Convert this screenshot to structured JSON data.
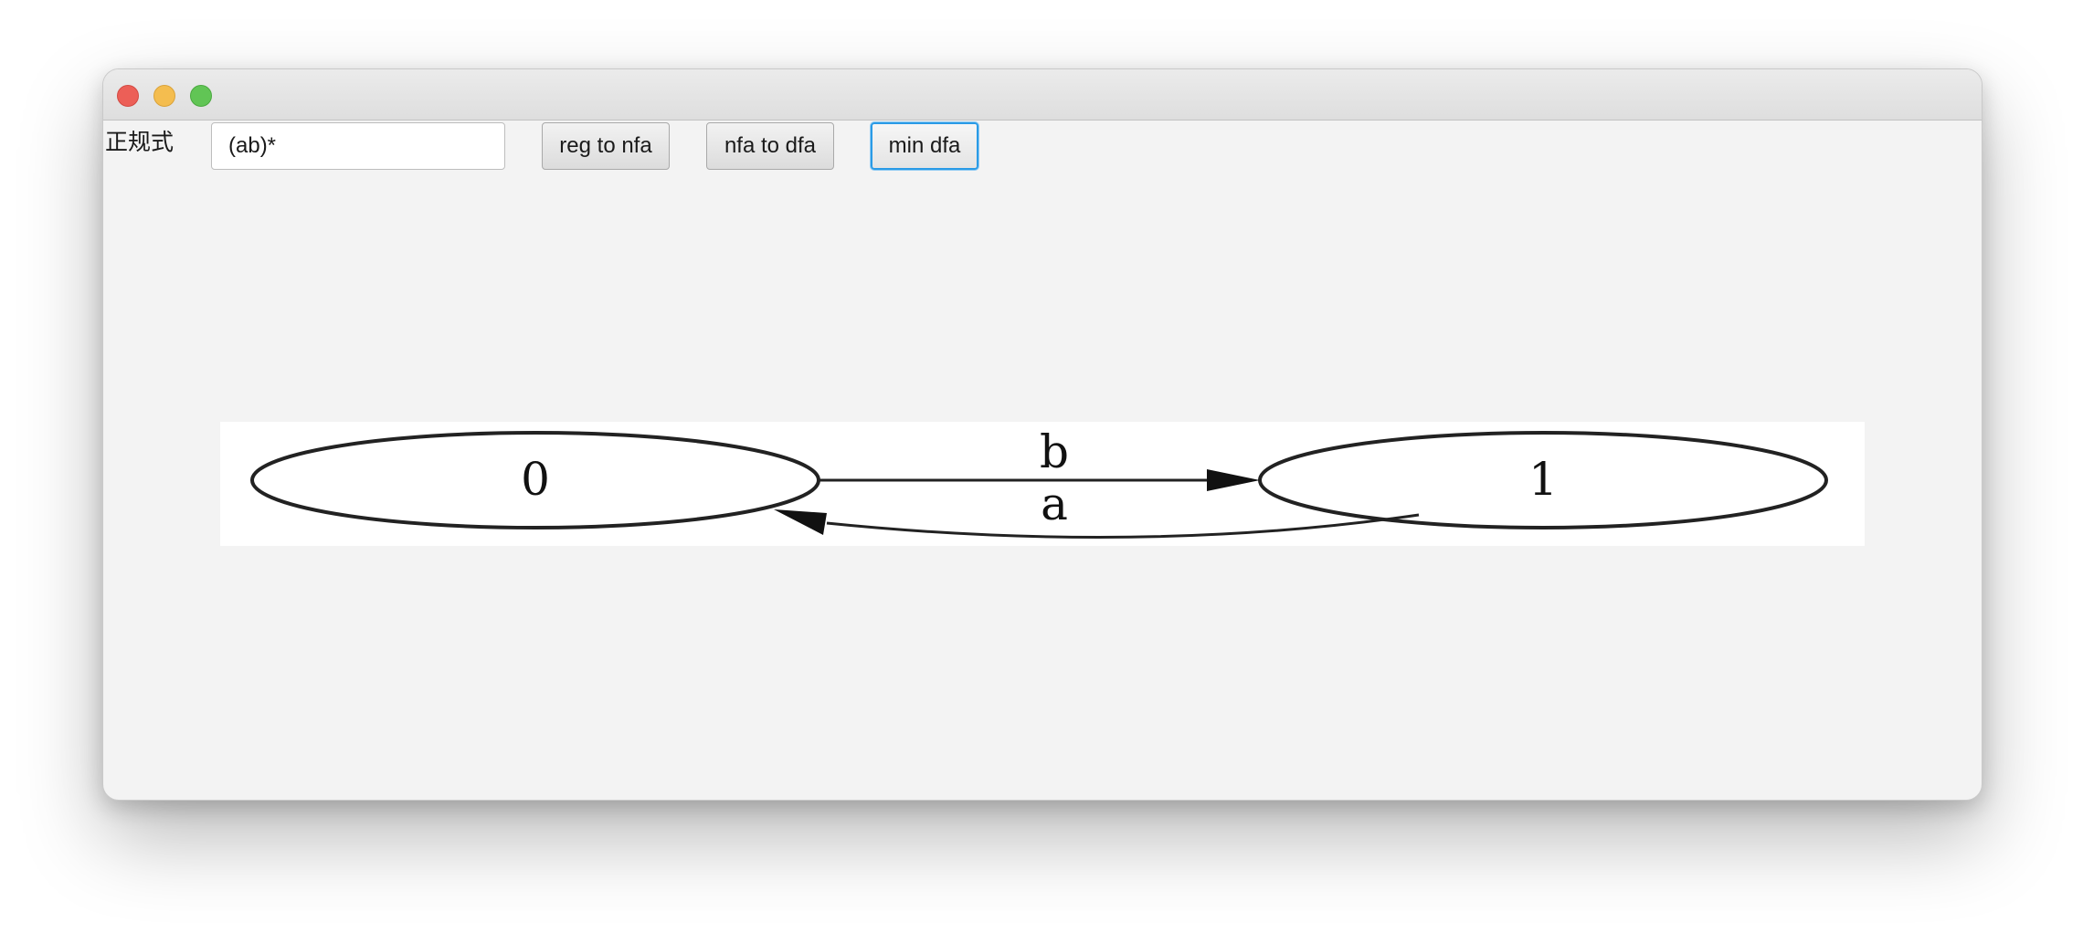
{
  "window": {
    "controls": {
      "close": "close-button",
      "minimize": "minimize-button",
      "maximize": "maximize-button"
    }
  },
  "toolbar": {
    "regex_label": "正规式",
    "regex_value": "(ab)*",
    "reg_to_nfa_label": "reg to nfa",
    "nfa_to_dfa_label": "nfa to dfa",
    "min_dfa_label": "min dfa"
  },
  "graph": {
    "nodes": [
      {
        "id": "0",
        "label": "0"
      },
      {
        "id": "1",
        "label": "1"
      }
    ],
    "edges": [
      {
        "from": "0",
        "to": "1",
        "label": "b"
      },
      {
        "from": "1",
        "to": "0",
        "label": "a"
      }
    ]
  }
}
